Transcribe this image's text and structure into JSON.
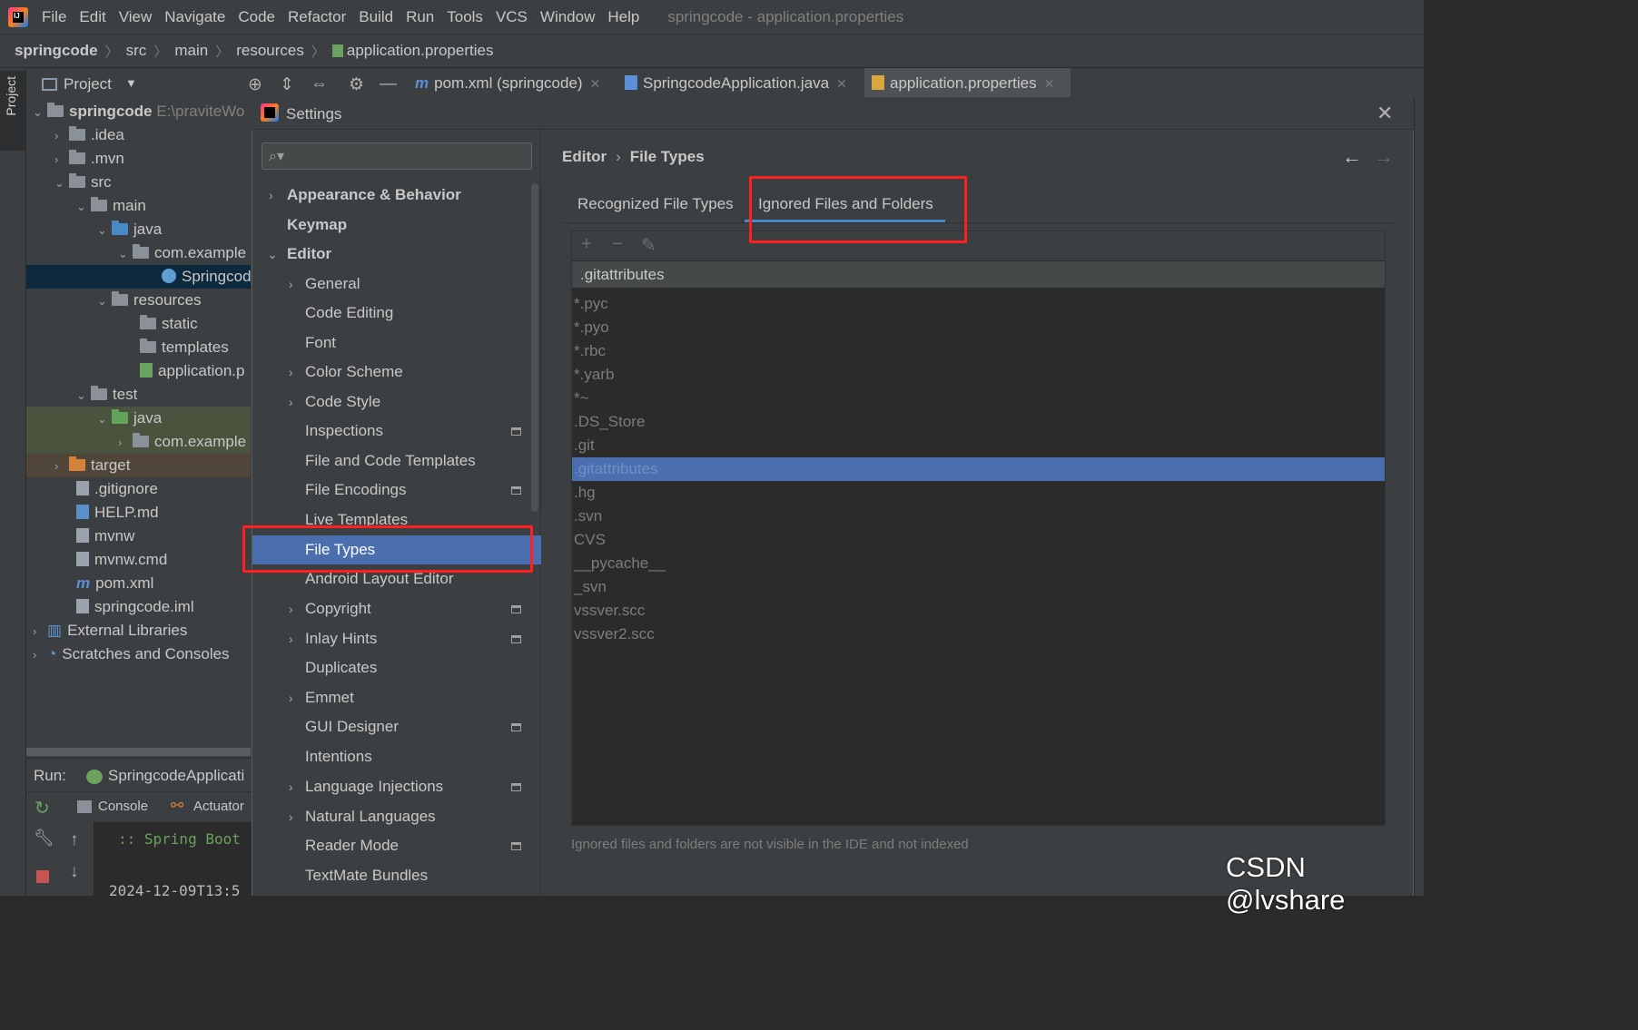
{
  "menubar": {
    "items": [
      "File",
      "Edit",
      "View",
      "Navigate",
      "Code",
      "Refactor",
      "Build",
      "Run",
      "Tools",
      "VCS",
      "Window",
      "Help"
    ],
    "window_title": "springcode - application.properties"
  },
  "breadcrumb": [
    "springcode",
    "src",
    "main",
    "resources",
    "application.properties"
  ],
  "project_panel": {
    "title": "Project",
    "stripe_label": "Project",
    "tree": [
      {
        "label": "springcode",
        "suffix": "E:\\praviteWo"
      },
      {
        "label": ".idea"
      },
      {
        "label": ".mvn"
      },
      {
        "label": "src"
      },
      {
        "label": "main"
      },
      {
        "label": "java"
      },
      {
        "label": "com.example"
      },
      {
        "label": "Springcod"
      },
      {
        "label": "resources"
      },
      {
        "label": "static"
      },
      {
        "label": "templates"
      },
      {
        "label": "application.p"
      },
      {
        "label": "test"
      },
      {
        "label": "java"
      },
      {
        "label": "com.example"
      },
      {
        "label": "target"
      },
      {
        "label": ".gitignore"
      },
      {
        "label": "HELP.md"
      },
      {
        "label": "mvnw"
      },
      {
        "label": "mvnw.cmd"
      },
      {
        "label": "pom.xml"
      },
      {
        "label": "springcode.iml"
      },
      {
        "label": "External Libraries"
      },
      {
        "label": "Scratches and Consoles"
      }
    ]
  },
  "editor_tabs": [
    "pom.xml (springcode)",
    "SpringcodeApplication.java",
    "application.properties"
  ],
  "run_panel": {
    "label": "Run:",
    "config": "SpringcodeApplicati",
    "tabs": [
      "Console",
      "Actuator"
    ],
    "console_lines": [
      ":: Spring Boot",
      "2024-12-09T13:5"
    ]
  },
  "settings": {
    "title": "Settings",
    "search_placeholder": "",
    "nav": [
      {
        "label": "Appearance & Behavior"
      },
      {
        "label": "Keymap"
      },
      {
        "label": "Editor"
      },
      {
        "label": "General"
      },
      {
        "label": "Code Editing"
      },
      {
        "label": "Font"
      },
      {
        "label": "Color Scheme"
      },
      {
        "label": "Code Style"
      },
      {
        "label": "Inspections"
      },
      {
        "label": "File and Code Templates"
      },
      {
        "label": "File Encodings"
      },
      {
        "label": "Live Templates"
      },
      {
        "label": "File Types"
      },
      {
        "label": "Android Layout Editor"
      },
      {
        "label": "Copyright"
      },
      {
        "label": "Inlay Hints"
      },
      {
        "label": "Duplicates"
      },
      {
        "label": "Emmet"
      },
      {
        "label": "GUI Designer"
      },
      {
        "label": "Intentions"
      },
      {
        "label": "Language Injections"
      },
      {
        "label": "Natural Languages"
      },
      {
        "label": "Reader Mode"
      },
      {
        "label": "TextMate Bundles"
      }
    ],
    "right": {
      "crumb_parent": "Editor",
      "crumb_current": "File Types",
      "tabs": [
        "Recognized File Types",
        "Ignored Files and Folders"
      ],
      "pattern_value": ".gitattributes",
      "patterns": [
        "*.pyc",
        "*.pyo",
        "*.rbc",
        "*.yarb",
        "*~",
        ".DS_Store",
        ".git",
        ".gitattributes",
        ".hg",
        ".svn",
        "CVS",
        "__pycache__",
        "_svn",
        "vssver.scc",
        "vssver2.scc"
      ],
      "selected_pattern": ".gitattributes",
      "note": "Ignored files and folders are not visible in the IDE and not indexed"
    }
  },
  "watermark": "CSDN @lvshare",
  "colors": {
    "selection": "#4b6eaf",
    "highlight_box": "#ff1f1f",
    "tab_underline": "#4a88c7"
  }
}
